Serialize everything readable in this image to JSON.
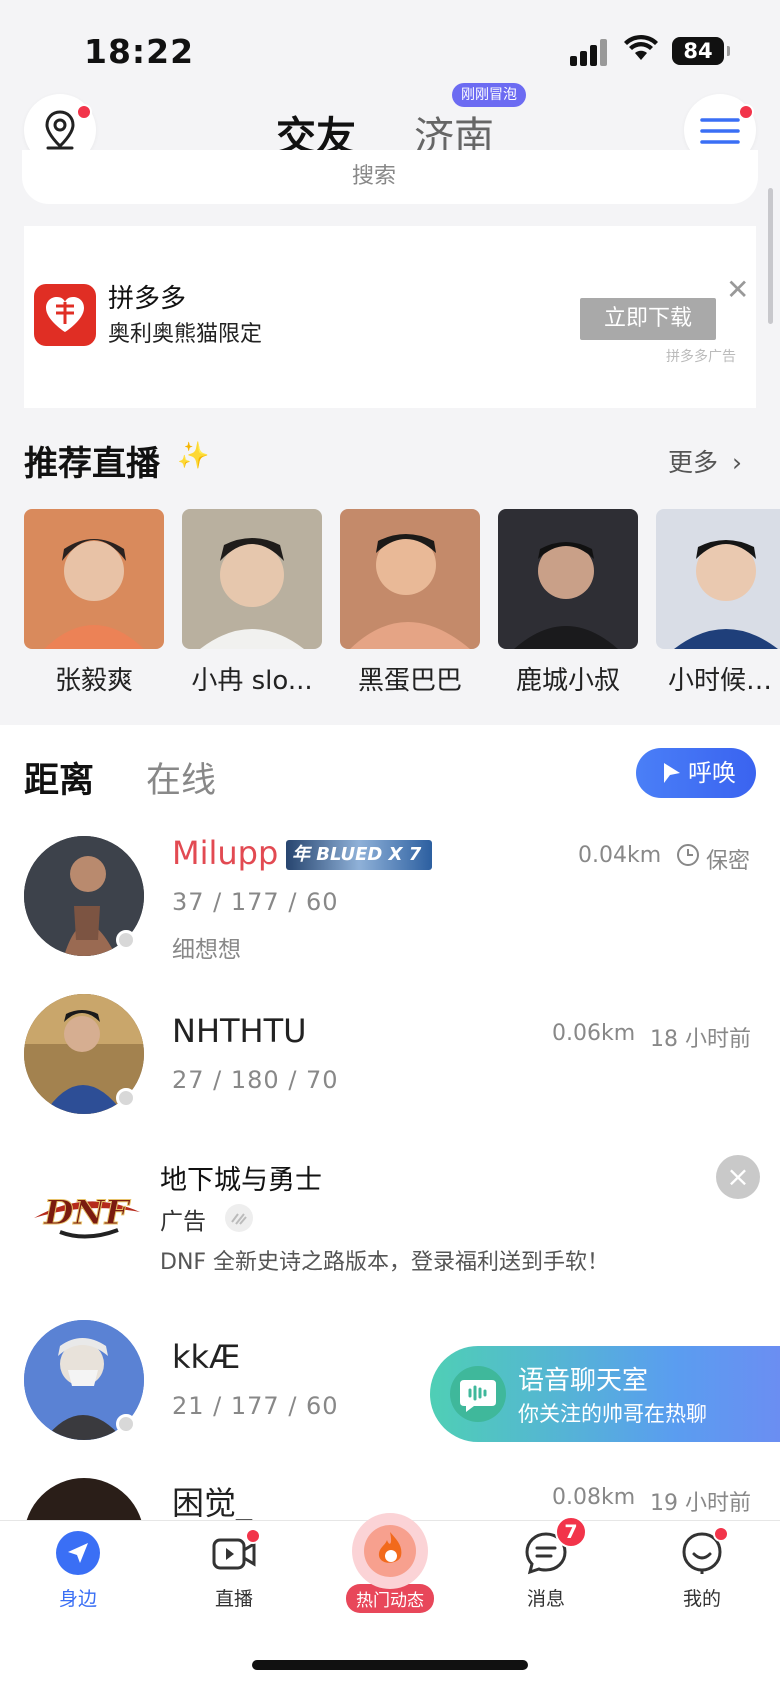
{
  "status_bar": {
    "time": "18:22",
    "battery": "84"
  },
  "header": {
    "tabs": [
      {
        "label": "交友",
        "active": true
      },
      {
        "label": "济南",
        "active": false
      }
    ],
    "city_badge": "刚刚冒泡",
    "icons": [
      "location-pin-icon",
      "menu-icon"
    ]
  },
  "search": {
    "placeholder": "搜索"
  },
  "ad": {
    "app_name": "拼多多",
    "subtitle": "奥利奥熊猫限定",
    "button": "立即下载",
    "source": "拼多多广告"
  },
  "live": {
    "title": "推荐直播",
    "more": "更多",
    "items": [
      {
        "name": "张毅爽",
        "color": "#d98a5c"
      },
      {
        "name": "小冉 slo...",
        "color": "#b9b09f"
      },
      {
        "name": "黑蛋巴巴",
        "color": "#c48a6a"
      },
      {
        "name": "鹿城小叔",
        "color": "#2e2e34"
      },
      {
        "name": "小时候…",
        "color": "#d9dde6"
      }
    ]
  },
  "filters": {
    "distance": "距离",
    "online": "在线",
    "call": "呼唤"
  },
  "users": [
    {
      "name": "Milupp",
      "badge_text": "年 BLUED X 7",
      "stats": "37 / 177 / 60",
      "bio": "细想想",
      "distance": "0.04km",
      "time": "保密",
      "name_color": "#e24a52"
    },
    {
      "name": "NHTHTU",
      "stats": "27 / 180 / 70",
      "distance": "0.06km",
      "time": "18 小时前"
    },
    {
      "name": "kkÆ",
      "stats": "21 / 177 / 60"
    },
    {
      "name": "困觉_",
      "distance": "0.08km",
      "time": "19 小时前"
    }
  ],
  "ad2": {
    "title": "地下城与勇士",
    "tag": "广告",
    "desc": "DNF 全新史诗之路版本，登录福利送到手软！",
    "logo_text": "DNF"
  },
  "voice_room": {
    "title": "语音聊天室",
    "subtitle": "你关注的帅哥在热聊"
  },
  "bottom_nav": [
    {
      "label": "身边",
      "active": true
    },
    {
      "label": "直播"
    },
    {
      "label": "热门动态"
    },
    {
      "label": "消息",
      "badge": "7"
    },
    {
      "label": "我的"
    }
  ],
  "colors": {
    "accent": "#3a6ff5",
    "red": "#f2344a"
  }
}
